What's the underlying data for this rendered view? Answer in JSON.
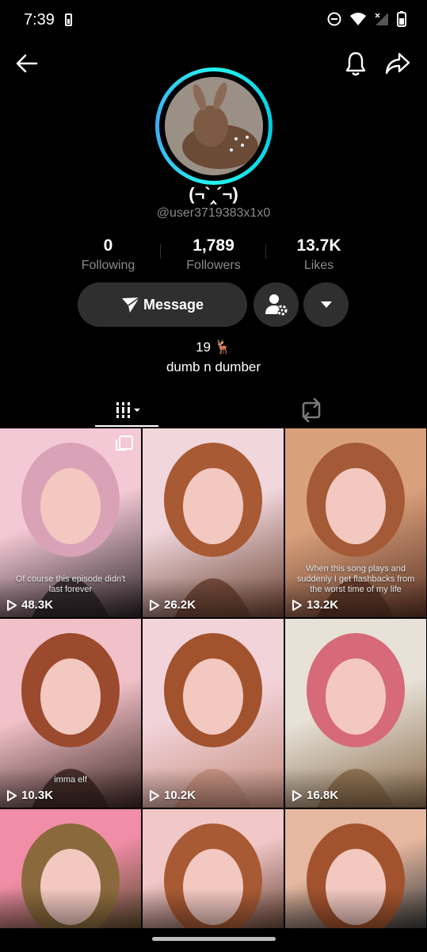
{
  "status_bar": {
    "time": "7:39"
  },
  "profile": {
    "display_name": "(¬`‸´¬)",
    "username": "@user3719383x1x0",
    "stats": [
      {
        "value": "0",
        "label": "Following"
      },
      {
        "value": "1,789",
        "label": "Followers"
      },
      {
        "value": "13.7K",
        "label": "Likes"
      }
    ],
    "message_label": "Message",
    "bio_line1": "19 🦌",
    "bio_line2": "dumb n dumber"
  },
  "icons": {
    "back": "back-arrow-icon",
    "bell": "bell-icon",
    "share": "share-icon",
    "message": "send-icon",
    "friends": "person-settings-icon",
    "more": "caret-down-icon",
    "grid": "grid-icon",
    "repost": "repost-icon"
  },
  "videos": [
    {
      "views": "48.3K",
      "caption": "Of course this episode didn't last forever",
      "multi": true,
      "palette": [
        "#f4c9d6",
        "#d9a2b6",
        "#2a2225"
      ]
    },
    {
      "views": "26.2K",
      "caption": "",
      "multi": false,
      "palette": [
        "#f1d7dc",
        "#a85a34",
        "#6a4030"
      ]
    },
    {
      "views": "13.2K",
      "caption": "When this song plays and suddenly I get flashbacks from the worst time of my life",
      "multi": false,
      "palette": [
        "#d9a07c",
        "#a45a36",
        "#5a3224"
      ]
    },
    {
      "views": "10.3K",
      "caption": "imma elf",
      "multi": false,
      "palette": [
        "#f1c0c8",
        "#9b4a2e",
        "#3a2420"
      ]
    },
    {
      "views": "10.2K",
      "caption": "",
      "multi": false,
      "palette": [
        "#f3d3da",
        "#a2532e",
        "#c28c7a"
      ]
    },
    {
      "views": "16.8K",
      "caption": "",
      "multi": false,
      "palette": [
        "#e7e1d8",
        "#d66a78",
        "#8a6a4a"
      ]
    },
    {
      "views": "",
      "caption": "",
      "multi": false,
      "palette": [
        "#f08da7",
        "#8a6a3c",
        "#5e4a2c"
      ]
    },
    {
      "views": "",
      "caption": "",
      "multi": false,
      "palette": [
        "#f1c7c7",
        "#a85a34",
        "#6f4a3a"
      ]
    },
    {
      "views": "",
      "caption": "",
      "multi": false,
      "palette": [
        "#e6b8a0",
        "#a2532e",
        "#3a3a3a"
      ]
    }
  ]
}
